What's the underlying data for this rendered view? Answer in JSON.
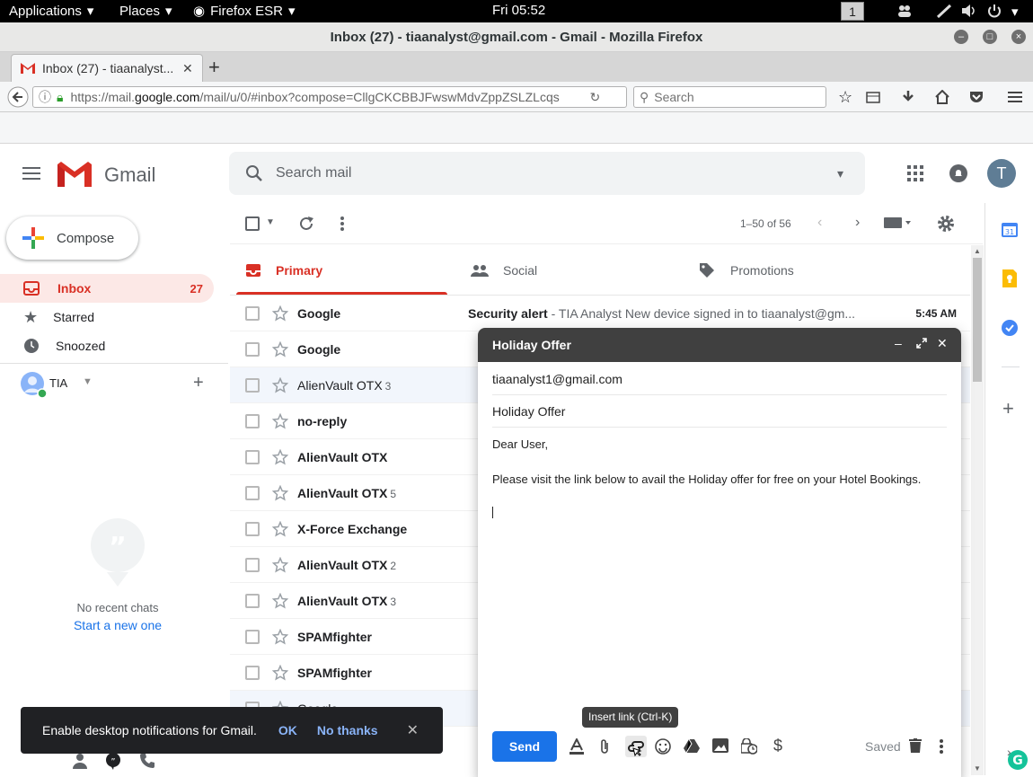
{
  "topbar": {
    "applications": "Applications",
    "places": "Places",
    "firefox": "Firefox ESR",
    "clock": "Fri 05:52",
    "workspace": "1"
  },
  "window": {
    "title": "Inbox (27) - tiaanalyst@gmail.com - Gmail - Mozilla Firefox"
  },
  "tab": {
    "label": "Inbox (27) - tiaanalyst..."
  },
  "nav": {
    "url_prefix": "https://mail.",
    "url_domain": "google.com",
    "url_rest": "/mail/u/0/#inbox?compose=CllgCKCBBJFwswMdvZppZSLZLcqs",
    "search_placeholder": "Search"
  },
  "gmail": {
    "brand": "Gmail",
    "search_placeholder": "Search mail",
    "avatar_letter": "T",
    "compose_label": "Compose",
    "pagination": "1–50 of 56",
    "nav": [
      {
        "label": "Inbox",
        "count": "27"
      },
      {
        "label": "Starred",
        "count": ""
      },
      {
        "label": "Snoozed",
        "count": ""
      }
    ],
    "hangouts_user": "TIA",
    "categories": {
      "primary": "Primary",
      "social": "Social",
      "promotions": "Promotions"
    },
    "chat_empty": "No recent chats",
    "chat_start": "Start a new one",
    "emails": [
      {
        "sender": "Google",
        "count": "",
        "subject": "Security alert",
        "snippet": " - TIA Analyst New device signed in to tiaanalyst@gm...",
        "time": "5:45 AM",
        "read": false
      },
      {
        "sender": "Google",
        "count": "",
        "subject": "",
        "snippet": "",
        "time": "",
        "read": false
      },
      {
        "sender": "AlienVault OTX",
        "count": "3",
        "subject": "",
        "snippet": "",
        "time": "",
        "read": true
      },
      {
        "sender": "no-reply",
        "count": "",
        "subject": "",
        "snippet": "",
        "time": "",
        "read": false
      },
      {
        "sender": "AlienVault OTX",
        "count": "",
        "subject": "",
        "snippet": "",
        "time": "",
        "read": false
      },
      {
        "sender": "AlienVault OTX",
        "count": "5",
        "subject": "",
        "snippet": "",
        "time": "",
        "read": false
      },
      {
        "sender": "X-Force Exchange",
        "count": "",
        "subject": "",
        "snippet": "",
        "time": "",
        "read": false
      },
      {
        "sender": "AlienVault OTX",
        "count": "2",
        "subject": "",
        "snippet": "",
        "time": "",
        "read": false
      },
      {
        "sender": "AlienVault OTX",
        "count": "3",
        "subject": "",
        "snippet": "",
        "time": "",
        "read": false
      },
      {
        "sender": "SPAMfighter",
        "count": "",
        "subject": "",
        "snippet": "",
        "time": "",
        "read": false
      },
      {
        "sender": "SPAMfighter",
        "count": "",
        "subject": "",
        "snippet": "",
        "time": "",
        "read": false
      },
      {
        "sender": "Google",
        "count": "",
        "subject": "",
        "snippet": "",
        "time": "",
        "read": true
      }
    ]
  },
  "compose": {
    "title": "Holiday Offer",
    "to": "tiaanalyst1@gmail.com",
    "subject": "Holiday Offer",
    "greeting": "Dear User,",
    "body": "Please visit the link below to avail the Holiday offer for free on your Hotel Bookings.",
    "send_label": "Send",
    "saved_label": "Saved",
    "tooltip": "Insert link (Ctrl-K)"
  },
  "notification": {
    "message": "Enable desktop notifications for Gmail.",
    "ok": "OK",
    "no_thanks": "No thanks"
  },
  "colors": {
    "gmail_red": "#d93025",
    "send_blue": "#1a73e8",
    "compose_header": "#404040"
  }
}
